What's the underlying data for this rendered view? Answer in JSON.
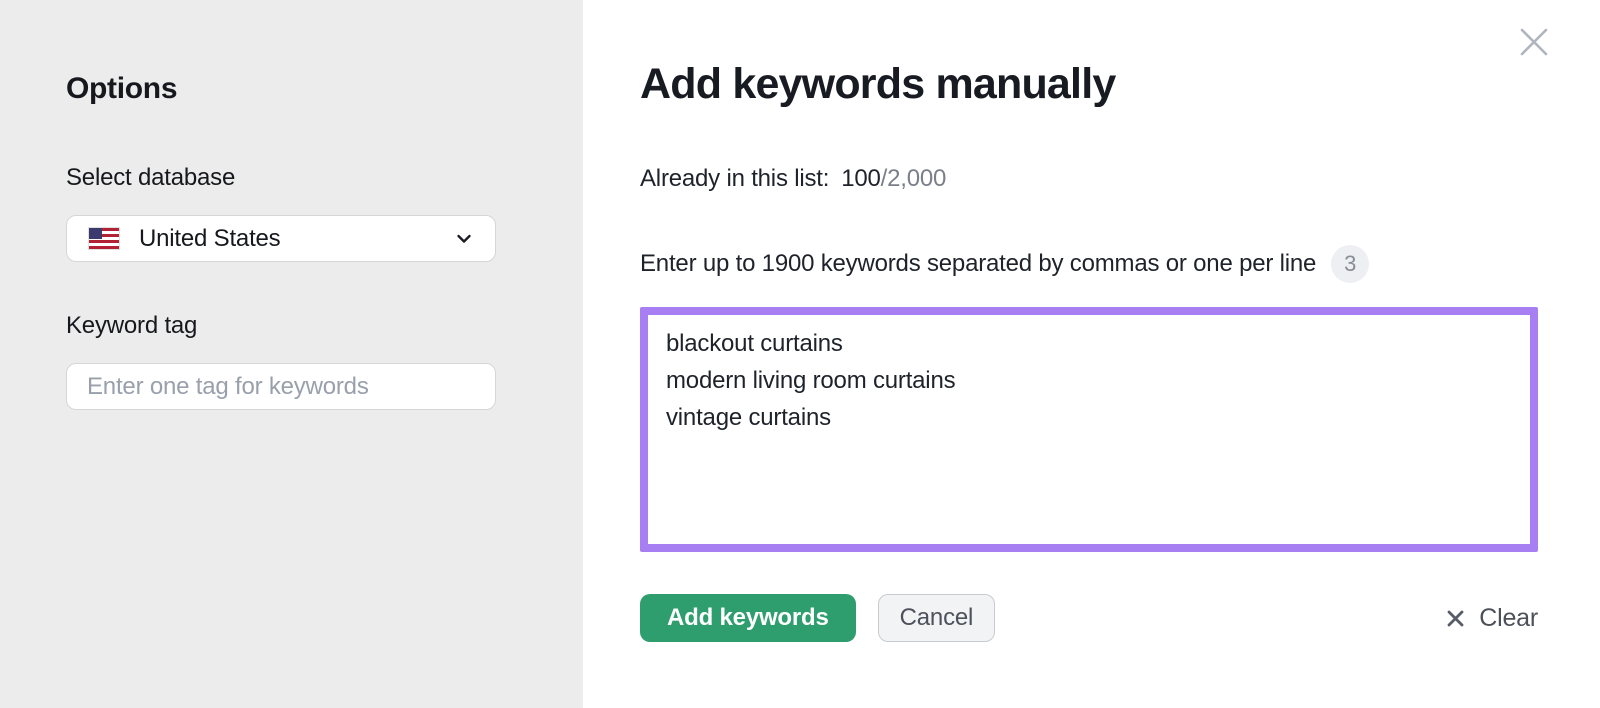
{
  "colors": {
    "sidebar_bg": "#ececec",
    "accent_purple": "#a87ff2",
    "primary_green": "#2f9e6e",
    "muted_gray": "#7b7f89"
  },
  "sidebar": {
    "title": "Options",
    "database": {
      "label": "Select database",
      "selected_value": "United States",
      "flag": "us-flag"
    },
    "keyword_tag": {
      "label": "Keyword tag",
      "placeholder": "Enter one tag for keywords",
      "value": ""
    }
  },
  "main": {
    "title": "Add keywords manually",
    "already_in_list": {
      "label": "Already in this list:",
      "current": "100",
      "total": "/2,000"
    },
    "instruction": "Enter up to 1900 keywords separated by commas or one per line",
    "keyword_count_badge": "3",
    "keywords_value": "blackout curtains\nmodern living room curtains\nvintage curtains",
    "buttons": {
      "add": "Add keywords",
      "cancel": "Cancel",
      "clear": "Clear"
    }
  }
}
